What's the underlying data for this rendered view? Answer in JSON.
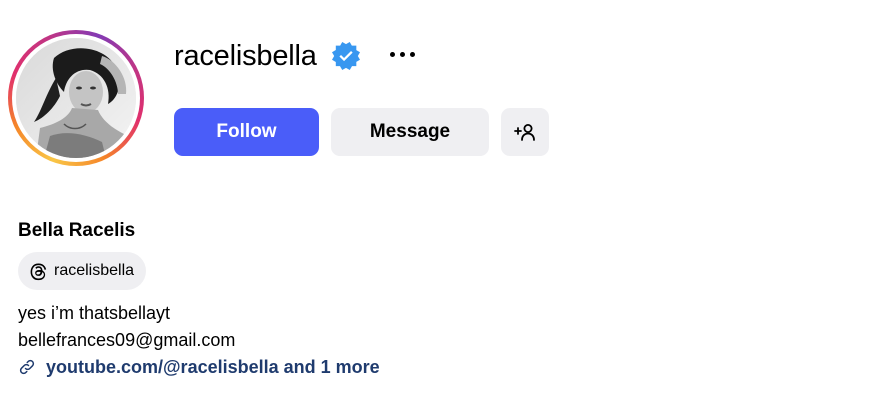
{
  "profile": {
    "username": "racelisbella",
    "full_name": "Bella Racelis",
    "threads_handle": "racelisbella",
    "bio_lines": [
      "yes i’m thatsbellayt",
      "bellefrances09@gmail.com"
    ],
    "link_text": "youtube.com/@racelisbella and 1 more",
    "verified": true
  },
  "actions": {
    "follow_label": "Follow",
    "message_label": "Message"
  },
  "icons": {
    "verified": "verified-badge-icon",
    "more": "more-options-icon",
    "add_user": "add-user-icon",
    "threads": "threads-icon",
    "link": "link-icon"
  },
  "colors": {
    "follow_bg": "#4a5df9",
    "secondary_bg": "#efeff2",
    "verified_blue": "#3897f0",
    "link_text": "#1f3b6e"
  }
}
